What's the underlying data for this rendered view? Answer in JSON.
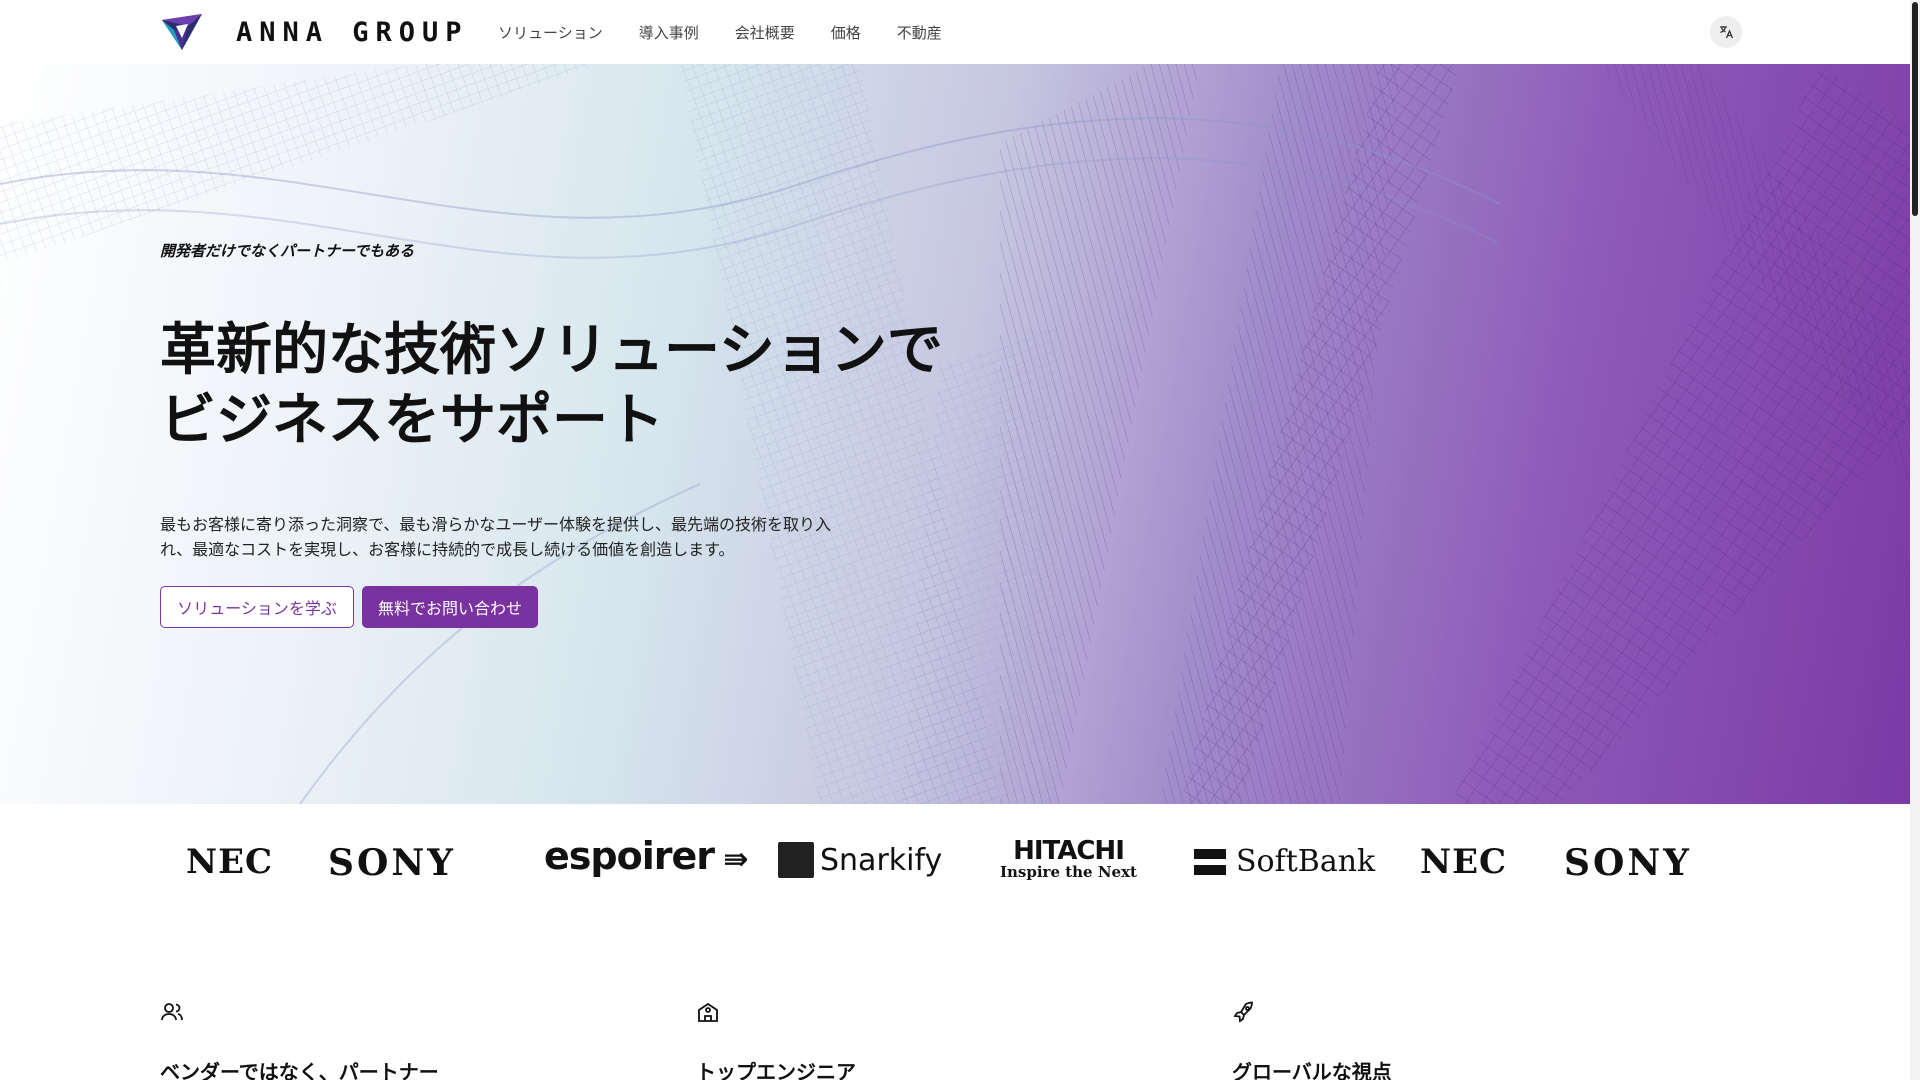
{
  "header": {
    "logo_text": "ANNA GROUP",
    "nav": [
      {
        "label": "ソリューション"
      },
      {
        "label": "導入事例"
      },
      {
        "label": "会社概要"
      },
      {
        "label": "価格"
      },
      {
        "label": "不動産"
      }
    ],
    "language_icon": "translate-icon"
  },
  "hero": {
    "tagline": "開発者だけでなくパートナーでもある",
    "title_line1": "革新的な技術ソリューションで",
    "title_line2": "ビジネスをサポート",
    "description": "最もお客様に寄り添った洞察で、最も滑らかなユーザー体験を提供し、最先端の技術を取り入れ、最適なコストを実現し、お客様に持続的で成長し続ける価値を創造します。",
    "primary_button": "ソリューションを学ぶ",
    "secondary_button": "無料でお問い合わせ"
  },
  "brands": [
    {
      "name": "NEC"
    },
    {
      "name": "SONY"
    },
    {
      "name": "espoirer"
    },
    {
      "name": "Snarkify"
    },
    {
      "name": "HITACHI",
      "tagline": "Inspire the Next"
    },
    {
      "name": "SoftBank"
    },
    {
      "name": "NEC"
    },
    {
      "name": "SONY"
    }
  ],
  "features": [
    {
      "icon": "users-icon",
      "title": "ベンダーではなく、パートナー"
    },
    {
      "icon": "school-icon",
      "title": "トップエンジニア"
    },
    {
      "icon": "rocket-icon",
      "title": "グローバルな視点"
    }
  ],
  "colors": {
    "accent": "#7a32a0",
    "hero_purple": "#7b3aa6"
  }
}
